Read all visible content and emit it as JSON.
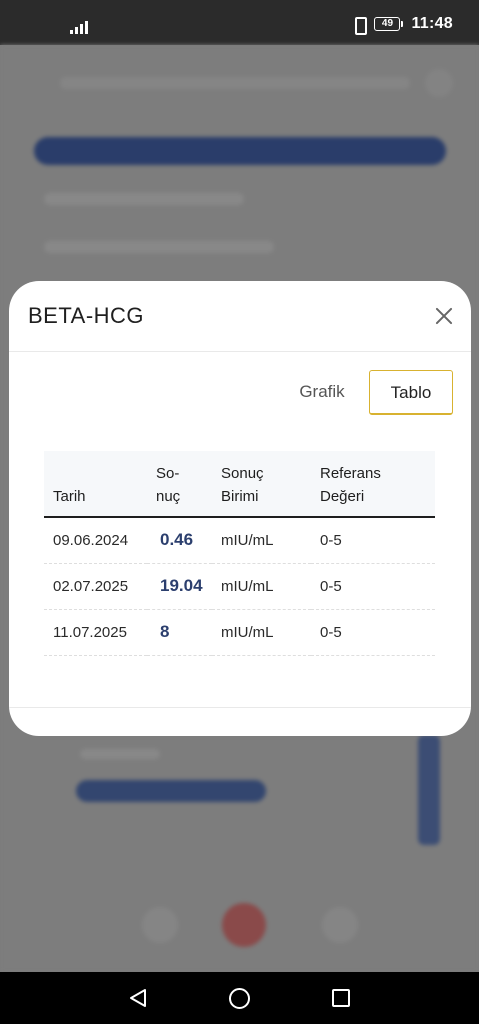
{
  "status_bar": {
    "time": "11:48",
    "battery": "49",
    "icons": [
      "signal-icon",
      "vibrate-icon",
      "battery-icon"
    ]
  },
  "modal": {
    "title": "BETA-HCG",
    "close_icon": "close-icon",
    "tabs": [
      {
        "label": "Grafik",
        "active": false
      },
      {
        "label": "Tablo",
        "active": true
      }
    ],
    "table": {
      "headers": {
        "date": "Tarih",
        "result_line1": "So-",
        "result_line2": "nuç",
        "unit_line1": "Sonuç",
        "unit_line2": "Birimi",
        "ref_line1": "Referans",
        "ref_line2": "Değeri"
      },
      "rows": [
        {
          "date": "09.06.2024",
          "value": "0.46",
          "unit": "mIU/mL",
          "ref": "0-5"
        },
        {
          "date": "02.07.2025",
          "value": "19.04",
          "unit": "mIU/mL",
          "ref": "0-5"
        },
        {
          "date": "11.07.2025",
          "value": "8",
          "unit": "mIU/mL",
          "ref": "0-5"
        }
      ]
    }
  },
  "colors": {
    "value_text": "#2c3f6e",
    "active_tab_border": "#d8b230",
    "overlay": "#7c7c7c"
  },
  "nav_bar": {
    "icons": [
      "back-icon",
      "home-icon",
      "recent-apps-icon"
    ]
  }
}
